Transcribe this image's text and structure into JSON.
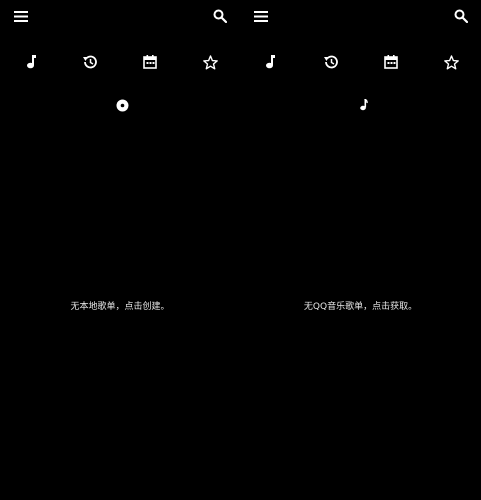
{
  "colors": {
    "background": "#000000",
    "foreground": "#ffffff"
  },
  "left_pane": {
    "toolbar": {
      "menu_icon": "menu-icon",
      "search_icon": "search-icon"
    },
    "tabs": [
      {
        "icon": "music-note-icon"
      },
      {
        "icon": "history-icon"
      },
      {
        "icon": "calendar-icon"
      },
      {
        "icon": "star-icon"
      }
    ],
    "active_indicator_icon": "disc-icon",
    "empty_message": "无本地歌单，点击创建。"
  },
  "right_pane": {
    "toolbar": {
      "menu_icon": "menu-icon",
      "search_icon": "search-icon"
    },
    "tabs": [
      {
        "icon": "music-note-icon"
      },
      {
        "icon": "history-icon"
      },
      {
        "icon": "calendar-icon"
      },
      {
        "icon": "star-icon"
      }
    ],
    "active_indicator_icon": "music-note-small-icon",
    "empty_message": "无QQ音乐歌单，点击获取。"
  }
}
